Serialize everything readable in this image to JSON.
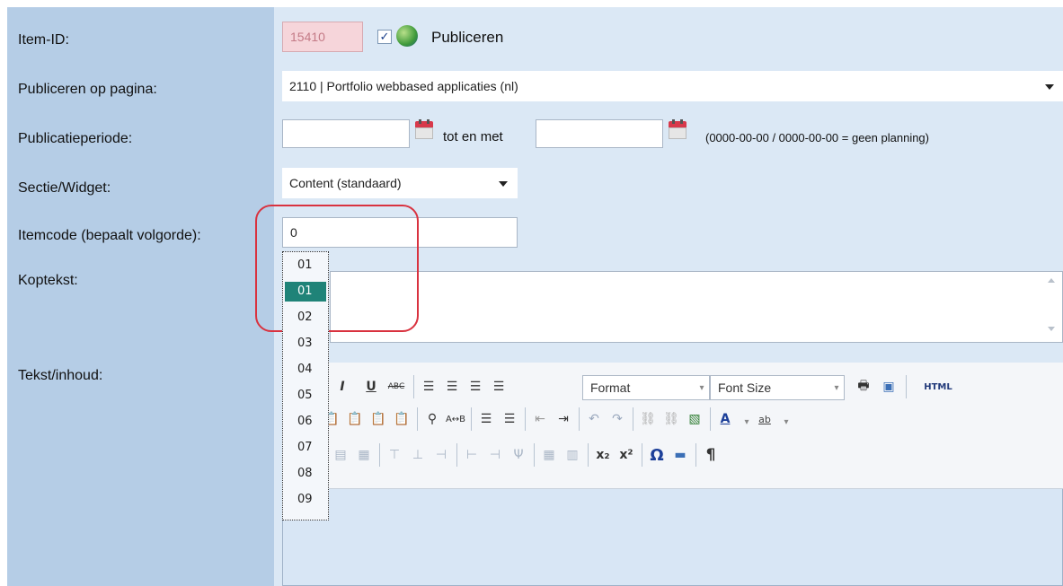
{
  "labels": {
    "item_id": "Item-ID:",
    "publish_on_page": "Publiceren op pagina:",
    "publication_period": "Publicatieperiode:",
    "section_widget": "Sectie/Widget:",
    "itemcode": "Itemcode (bepaalt volgorde):",
    "koptekst": "Koptekst:",
    "tekst_inhoud": "Tekst/inhoud:"
  },
  "item_id": {
    "value": "15410",
    "publish_checked": true,
    "publish_label": "Publiceren"
  },
  "page_select": {
    "value": "2110 | Portfolio webbased applicaties (nl)"
  },
  "period": {
    "start": "",
    "end": "",
    "between_label": "tot en met",
    "hint": "(0000-00-00 / 0000-00-00 = geen planning)"
  },
  "section_select": {
    "value": "Content (standaard)"
  },
  "itemcode": {
    "value": "0",
    "options": [
      "01",
      "01",
      "02",
      "03",
      "04",
      "05",
      "06",
      "07",
      "08",
      "09"
    ],
    "selected_index": 1
  },
  "editor": {
    "format_label": "Format",
    "fontsize_label": "Font Size",
    "html_label": "HTML"
  }
}
